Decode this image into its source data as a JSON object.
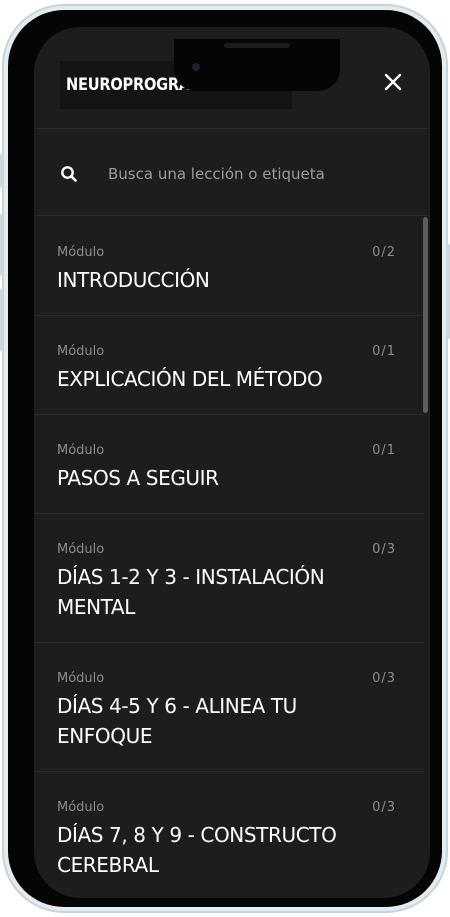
{
  "header": {
    "title": "NEUROPROGRAMACIÓN ALFA"
  },
  "search": {
    "placeholder": "Busca una lección o etiqueta",
    "value": ""
  },
  "modules": [
    {
      "label": "Módulo",
      "title": "INTRODUCCIÓN",
      "progress": "0/2"
    },
    {
      "label": "Módulo",
      "title": "EXPLICACIÓN DEL MÉTODO",
      "progress": "0/1"
    },
    {
      "label": "Módulo",
      "title": "PASOS A SEGUIR",
      "progress": "0/1"
    },
    {
      "label": "Módulo",
      "title": "DÍAS 1-2 Y 3 - INSTALACIÓN MENTAL",
      "progress": "0/3"
    },
    {
      "label": "Módulo",
      "title": "DÍAS 4-5 Y 6 - ALINEA TU ENFOQUE",
      "progress": "0/3"
    },
    {
      "label": "Módulo",
      "title": "DÍAS 7, 8 Y 9 - CONSTRUCTO CEREBRAL",
      "progress": "0/3"
    }
  ],
  "icons": {
    "close": "close-icon",
    "search": "search-icon"
  },
  "colors": {
    "background": "#1d1d1e",
    "text": "#ffffff",
    "muted": "#8c8c8c",
    "divider": "#2a2a2b"
  }
}
